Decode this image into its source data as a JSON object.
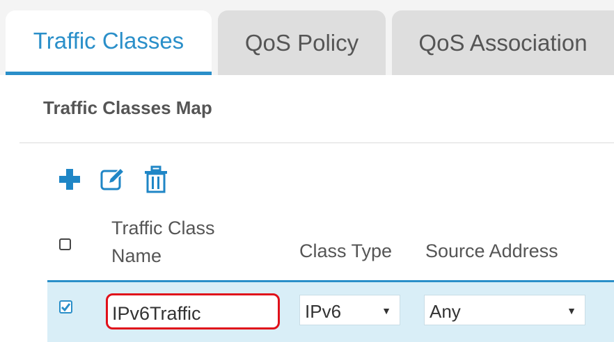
{
  "tabs": {
    "traffic_classes": "Traffic Classes",
    "qos_policy": "QoS Policy",
    "qos_association": "QoS Association"
  },
  "panel": {
    "title": "Traffic Classes Map"
  },
  "toolbar": {
    "add_icon": "plus-icon",
    "edit_icon": "edit-icon",
    "delete_icon": "trash-icon"
  },
  "table": {
    "headers": {
      "name_line1": "Traffic Class",
      "name_line2": "Name",
      "class_type": "Class Type",
      "source_address": "Source Address"
    },
    "rows": [
      {
        "selected": true,
        "name": "IPv6Traffic",
        "class_type": "IPv6",
        "source_address": "Any"
      }
    ]
  },
  "colors": {
    "accent": "#2a8fc9",
    "selected_row": "#d9eef7",
    "highlight": "#e0101a"
  }
}
